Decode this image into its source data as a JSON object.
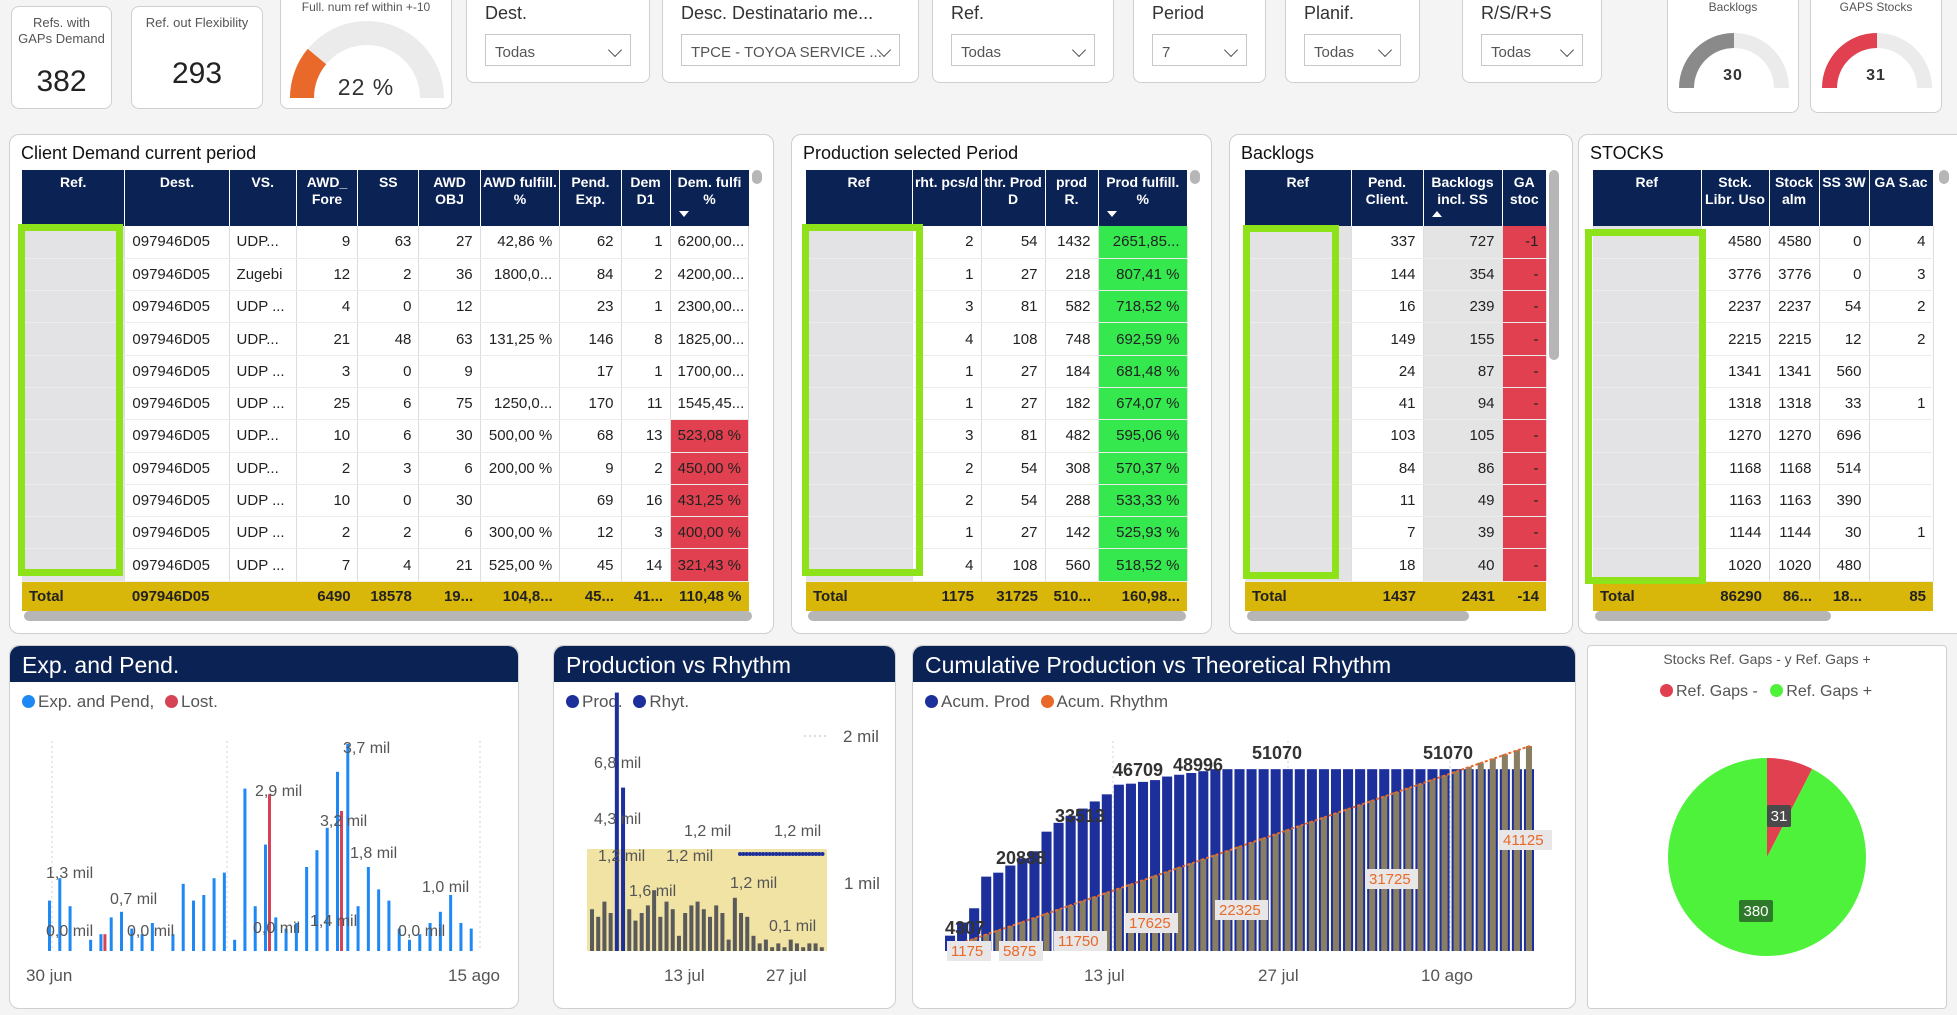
{
  "kpis": [
    {
      "label": "Refs. with GAPs Demand",
      "value": "382"
    },
    {
      "label": "Ref. out Flexibility",
      "value": "293"
    }
  ],
  "gauge_main": {
    "label": "Full. num ref within +-10",
    "value": "22 %",
    "fraction": 0.22,
    "color": "#e8692a"
  },
  "slicers": [
    {
      "label": "Dest.",
      "value": "Todas"
    },
    {
      "label": "Desc. Destinatario me...",
      "value": "TPCE - TOYOA SERVICE ..."
    },
    {
      "label": "Ref.",
      "value": "Todas"
    },
    {
      "label": "Period",
      "value": "7"
    },
    {
      "label": "Planif.",
      "value": "Todas"
    },
    {
      "label": "R/S/R+S",
      "value": "Todas"
    }
  ],
  "gauge_backlogs": {
    "label": "Backlogs",
    "value": "30",
    "fraction": 0.5,
    "color": "#8a8a8a"
  },
  "gauge_gaps": {
    "label": "GAPS Stocks",
    "value": "31",
    "fraction": 0.5,
    "color": "#e0404f"
  },
  "colors": {
    "navy": "#0b2254",
    "green": "#34e84e",
    "red": "#e0404f",
    "total": "#d9b60a",
    "highlight": "#8ee21a"
  },
  "client": {
    "title": "Client Demand current period",
    "headers": [
      "Ref.",
      "Dest.",
      "VS.",
      "AWD_ Fore",
      "SS",
      "AWD OBJ",
      "AWD fulfill. %",
      "Pend. Exp.",
      "Dem D1",
      "Dem. fulfi %"
    ],
    "rows": [
      [
        "",
        "097946D05",
        "UDP...",
        "9",
        "63",
        "27",
        "42,86 %",
        "62",
        "1",
        "6200,00..."
      ],
      [
        "",
        "097946D05",
        "Zugebi",
        "12",
        "2",
        "36",
        "1800,0...",
        "84",
        "2",
        "4200,00..."
      ],
      [
        "",
        "097946D05",
        "UDP ...",
        "4",
        "0",
        "12",
        "",
        "23",
        "1",
        "2300,00..."
      ],
      [
        "",
        "097946D05",
        "UDP...",
        "21",
        "48",
        "63",
        "131,25 %",
        "146",
        "8",
        "1825,00..."
      ],
      [
        "",
        "097946D05",
        "UDP ...",
        "3",
        "0",
        "9",
        "",
        "17",
        "1",
        "1700,00..."
      ],
      [
        "",
        "097946D05",
        "UDP ...",
        "25",
        "6",
        "75",
        "1250,0...",
        "170",
        "11",
        "1545,45..."
      ],
      [
        "",
        "097946D05",
        "UDP...",
        "10",
        "6",
        "30",
        "500,00 %",
        "68",
        "13",
        "523,08 %"
      ],
      [
        "",
        "097946D05",
        "UDP...",
        "2",
        "3",
        "6",
        "200,00 %",
        "9",
        "2",
        "450,00 %"
      ],
      [
        "",
        "097946D05",
        "UDP ...",
        "10",
        "0",
        "30",
        "",
        "69",
        "16",
        "431,25 %"
      ],
      [
        "",
        "097946D05",
        "UDP ...",
        "2",
        "2",
        "6",
        "300,00 %",
        "12",
        "3",
        "400,00 %"
      ],
      [
        "",
        "097946D05",
        "UDP ...",
        "7",
        "4",
        "21",
        "525,00 %",
        "45",
        "14",
        "321,43 %"
      ]
    ],
    "total": [
      "Total",
      "097946D05",
      "",
      "6490",
      "18578",
      "19...",
      "104,8...",
      "45...",
      "41...",
      "110,48 %"
    ]
  },
  "production": {
    "title": "Production selected Period",
    "headers": [
      "Ref",
      "rht. pcs/d",
      "thr. Prod D",
      "prod R.",
      "Prod fulfill. %"
    ],
    "rows": [
      [
        "",
        "2",
        "54",
        "1432",
        "2651,85..."
      ],
      [
        "",
        "1",
        "27",
        "218",
        "807,41 %"
      ],
      [
        "",
        "3",
        "81",
        "582",
        "718,52 %"
      ],
      [
        "",
        "4",
        "108",
        "748",
        "692,59 %"
      ],
      [
        "",
        "1",
        "27",
        "184",
        "681,48 %"
      ],
      [
        "",
        "1",
        "27",
        "182",
        "674,07 %"
      ],
      [
        "",
        "3",
        "81",
        "482",
        "595,06 %"
      ],
      [
        "",
        "2",
        "54",
        "308",
        "570,37 %"
      ],
      [
        "",
        "2",
        "54",
        "288",
        "533,33 %"
      ],
      [
        "",
        "1",
        "27",
        "142",
        "525,93 %"
      ],
      [
        "",
        "4",
        "108",
        "560",
        "518,52 %"
      ]
    ],
    "total": [
      "Total",
      "1175",
      "31725",
      "510...",
      "160,98..."
    ]
  },
  "backlogs": {
    "title": "Backlogs",
    "headers": [
      "Ref",
      "Pend. Client.",
      "Backlogs incl. SS",
      "GA stoc"
    ],
    "rows": [
      [
        "",
        "337",
        "727",
        "-1"
      ],
      [
        "",
        "144",
        "354",
        "-"
      ],
      [
        "",
        "16",
        "239",
        "-"
      ],
      [
        "",
        "149",
        "155",
        "-"
      ],
      [
        "",
        "24",
        "87",
        "-"
      ],
      [
        "",
        "41",
        "94",
        "-"
      ],
      [
        "",
        "103",
        "105",
        "-"
      ],
      [
        "",
        "84",
        "86",
        "-"
      ],
      [
        "",
        "11",
        "49",
        "-"
      ],
      [
        "",
        "7",
        "39",
        "-"
      ],
      [
        "",
        "18",
        "40",
        "-"
      ]
    ],
    "total": [
      "Total",
      "1437",
      "2431",
      "-14"
    ]
  },
  "stocks": {
    "title": "STOCKS",
    "headers": [
      "Ref",
      "Stck. Libr. Uso",
      "Stock alm",
      "SS 3W",
      "GA S.ac"
    ],
    "rows": [
      [
        "",
        "4580",
        "4580",
        "0",
        "4"
      ],
      [
        "",
        "3776",
        "3776",
        "0",
        "3"
      ],
      [
        "",
        "2237",
        "2237",
        "54",
        "2"
      ],
      [
        "",
        "2215",
        "2215",
        "12",
        "2"
      ],
      [
        "",
        "1341",
        "1341",
        "560",
        ""
      ],
      [
        "",
        "1318",
        "1318",
        "33",
        "1"
      ],
      [
        "",
        "1270",
        "1270",
        "696",
        ""
      ],
      [
        "",
        "1168",
        "1168",
        "514",
        ""
      ],
      [
        "",
        "1163",
        "1163",
        "390",
        ""
      ],
      [
        "",
        "1144",
        "1144",
        "30",
        "1"
      ],
      [
        "",
        "1020",
        "1020",
        "480",
        ""
      ]
    ],
    "total": [
      "Total",
      "86290",
      "86...",
      "18...",
      "85"
    ]
  },
  "chart_data": [
    {
      "type": "bar",
      "title": "Exp. and Pend.",
      "series": [
        {
          "name": "Exp. and Pend,",
          "color": "#1e88f5"
        },
        {
          "name": "Lost.",
          "color": "#d64356"
        }
      ],
      "x_ticks": [
        "30 jun",
        "15 ago"
      ],
      "labels": [
        "1,3 mil",
        "0,0 mil",
        "0,7 mil",
        "0,0 mil",
        "2,9 mil",
        "0,0 mil",
        "1,4 mil",
        "3,2 mil",
        "3,7 mil",
        "1,8 mil",
        "0,0 mil",
        "1,0 mil"
      ],
      "values_k": [
        0.9,
        1.3,
        0.8,
        0,
        0.2,
        0.3,
        0.6,
        0.7,
        0.4,
        0.3,
        0.5,
        0,
        0.3,
        1.2,
        0.9,
        1.0,
        1.3,
        1.4,
        0.2,
        2.9,
        0.8,
        1.9,
        0.6,
        0.4,
        0.5,
        1.5,
        1.8,
        2.2,
        3.2,
        3.7,
        0.8,
        1.5,
        1.1,
        0.9,
        0.4,
        0.2,
        0.3,
        0.5,
        0.7,
        1.0,
        0.5,
        0.4
      ],
      "lost_k": [
        0,
        0,
        0,
        0,
        0,
        0.3,
        0,
        0,
        0,
        0,
        0,
        0,
        0,
        0,
        0,
        0,
        0,
        0,
        0,
        0,
        0,
        2.8,
        0,
        0,
        0,
        0,
        0,
        0,
        2.5,
        0,
        0,
        0,
        0,
        0,
        0,
        0,
        0,
        0,
        0,
        0,
        0,
        0
      ]
    },
    {
      "type": "bar",
      "title": "Production vs Rhythm",
      "series": [
        {
          "name": "Prod.",
          "color": "#1c2f9a"
        },
        {
          "name": "Rhyt.",
          "color": "#1c2f9a"
        }
      ],
      "x_ticks": [
        "13 jul",
        "27 jul"
      ],
      "y2_ticks": [
        "2 mil",
        "1 mil"
      ],
      "labels": [
        "6,8 mil",
        "4,3 mil",
        "1,2 mil",
        "1,6 mil",
        "1,2 mil",
        "1,2 mil",
        "1,2 mil",
        "1,2 mil",
        "0,1 mil"
      ],
      "values_k": [
        1.1,
        0.9,
        1.3,
        1.0,
        6.8,
        4.3,
        1.1,
        0.8,
        1.0,
        1.2,
        1.6,
        0.9,
        1.3,
        1.1,
        0.4,
        1.0,
        1.2,
        1.3,
        1.1,
        0.9,
        1.2,
        1.0,
        0.3,
        1.4,
        1.0,
        0.9,
        0.4,
        0.2,
        0.3,
        0.1,
        0.2,
        0.1,
        0.3,
        0.2,
        0.1,
        0.2,
        0.2,
        0.1
      ],
      "rhythm_k": 1.2
    },
    {
      "type": "bar",
      "title": "Cumulative Production vs Theoretical Rhythm",
      "series": [
        {
          "name": "Acum. Prod",
          "color": "#1c2f9a"
        },
        {
          "name": "Acum. Rhythm",
          "color": "#e8692a"
        }
      ],
      "x_ticks": [
        "13 jul",
        "27 jul",
        "10 ago"
      ],
      "prod_labels": [
        "4307",
        "20888",
        "33513",
        "46709",
        "48996",
        "51070",
        "51070"
      ],
      "rhythm_labels": [
        "1175",
        "5875",
        "11750",
        "17625",
        "22325",
        "31725",
        "41125"
      ],
      "prod_values": [
        4307,
        8000,
        12000,
        20888,
        22000,
        24000,
        26000,
        28000,
        33513,
        36000,
        38000,
        40000,
        42000,
        44000,
        46709,
        47000,
        47500,
        48000,
        48996,
        49500,
        50000,
        50500,
        51070,
        51070,
        51070,
        51070,
        51070,
        51070,
        51070,
        51070,
        51070,
        51070,
        51070,
        51070,
        51070,
        51070,
        51070,
        51070,
        51070,
        51070,
        51070,
        51070,
        51070,
        51070,
        51070,
        51070,
        51070,
        51070,
        51070
      ],
      "rhythm_values": [
        1175,
        2350,
        3525,
        4700,
        5875,
        7050,
        8225,
        9400,
        10575,
        11750,
        12925,
        14100,
        15275,
        16450,
        17625,
        18800,
        19975,
        21150,
        22325,
        23500,
        24675,
        25850,
        27025,
        28200,
        29375,
        30550,
        31725,
        32900,
        34075,
        35250,
        36425,
        37600,
        38775,
        39950,
        41125,
        42300,
        43475,
        44650,
        45825,
        47000,
        48175,
        49350,
        50525,
        51700,
        52875,
        54050,
        55225,
        56400,
        57575
      ]
    },
    {
      "type": "pie",
      "title": "Stocks Ref. Gaps - y Ref. Gaps +",
      "labels": [
        "Ref. Gaps -",
        "Ref. Gaps +"
      ],
      "values": [
        31,
        380
      ],
      "colors": [
        "#e0404f",
        "#4ef23a"
      ]
    }
  ]
}
